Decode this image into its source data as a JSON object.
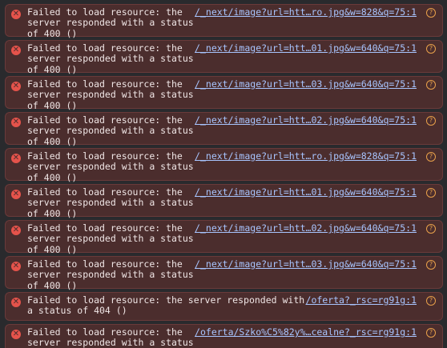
{
  "colors": {
    "background": "#292a2d",
    "entry_bg": "#4b2d2d",
    "entry_border": "#6a3a3a",
    "error_icon": "#e5534b",
    "message_text": "#f0e6e6",
    "link": "#a8c5ff",
    "action_icon": "#e8a04a"
  },
  "icons": {
    "error": "error-circle-x-icon",
    "action": "ai-explain-icon"
  },
  "entries": [
    {
      "message": "Failed to load resource: the\nserver responded with a status\nof 400 ()",
      "source": "/_next/image?url=htt…ro.jpg&w=828&q=75:1"
    },
    {
      "message": "Failed to load resource: the\nserver responded with a status\nof 400 ()",
      "source": "/_next/image?url=htt…01.jpg&w=640&q=75:1"
    },
    {
      "message": "Failed to load resource: the\nserver responded with a status\nof 400 ()",
      "source": "/_next/image?url=htt…03.jpg&w=640&q=75:1"
    },
    {
      "message": "Failed to load resource: the\nserver responded with a status\nof 400 ()",
      "source": "/_next/image?url=htt…02.jpg&w=640&q=75:1"
    },
    {
      "message": "Failed to load resource: the\nserver responded with a status\nof 400 ()",
      "source": "/_next/image?url=htt…ro.jpg&w=828&q=75:1"
    },
    {
      "message": "Failed to load resource: the\nserver responded with a status\nof 400 ()",
      "source": "/_next/image?url=htt…01.jpg&w=640&q=75:1"
    },
    {
      "message": "Failed to load resource: the\nserver responded with a status\nof 400 ()",
      "source": "/_next/image?url=htt…02.jpg&w=640&q=75:1"
    },
    {
      "message": "Failed to load resource: the\nserver responded with a status\nof 400 ()",
      "source": "/_next/image?url=htt…03.jpg&w=640&q=75:1"
    },
    {
      "message": "Failed to load resource: the server responded with\na status of 404 ()",
      "source": "/oferta?_rsc=rg91g:1"
    },
    {
      "message": "Failed to load resource: the\nserver responded with a status\nof 404 ()",
      "source": "/oferta/Szko%C5%82y%…cealne?_rsc=rg91g:1"
    }
  ]
}
